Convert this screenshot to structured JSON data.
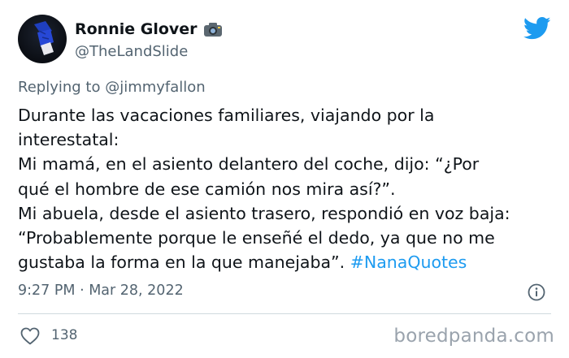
{
  "user": {
    "display_name": "Ronnie Glover",
    "handle": "@TheLandSlide",
    "badge_icon": "camera-icon"
  },
  "brand_icon": "twitter-bird-icon",
  "reply": {
    "prefix": "Replying to ",
    "mention": "@jimmyfallon"
  },
  "tweet": {
    "text": "Durante las vacaciones familiares, viajando por la\ninterestatal:\nMi mamá, en el asiento delantero del coche, dijo: “¿Por\nqué el hombre de ese camión nos mira así?”.\nMi abuela, desde el asiento trasero, respondió en voz baja:\n“Probablemente porque le enseñé el dedo, ya que no me\ngustaba la forma en la que manejaba”. ",
    "hashtag": "#NanaQuotes"
  },
  "meta": {
    "timestamp": "9:27 PM · Mar 28, 2022",
    "info_icon": "info-icon"
  },
  "actions": {
    "like_icon": "heart-icon",
    "like_count": "138"
  },
  "watermark": "boredpanda.com",
  "colors": {
    "text": "#0f1419",
    "secondary": "#536471",
    "accent": "#1d9bf0",
    "divider": "#cfd9de"
  }
}
